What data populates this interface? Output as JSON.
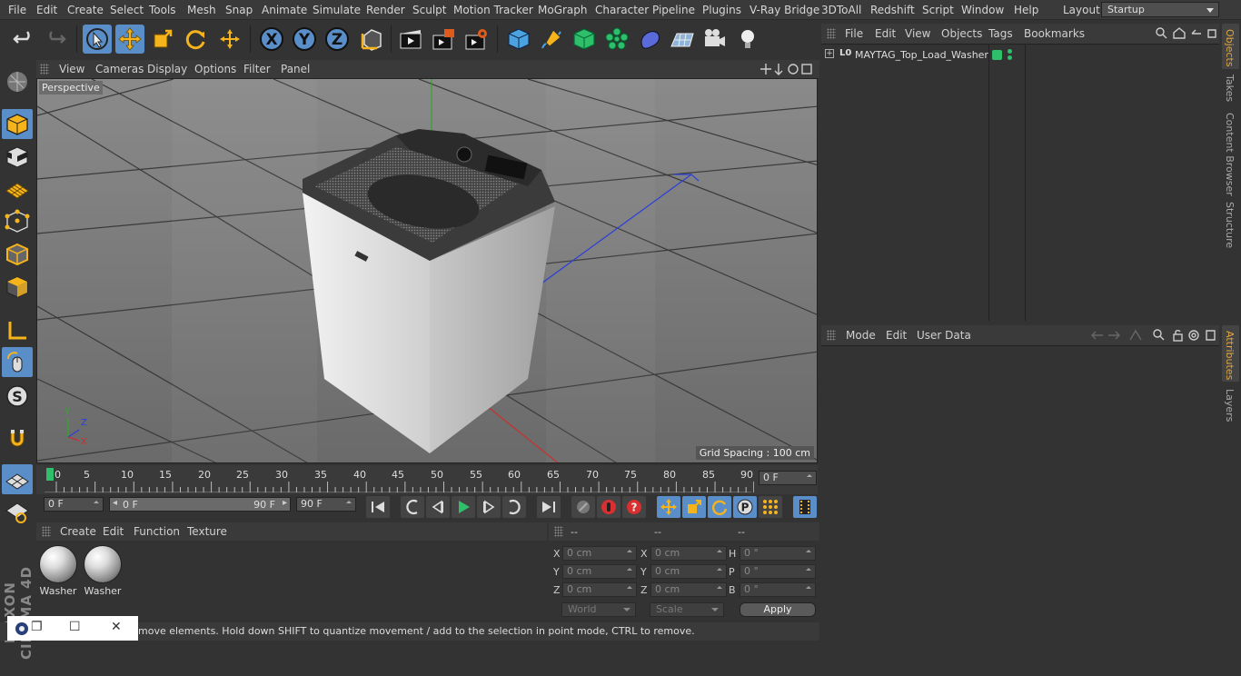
{
  "menubar": {
    "items": [
      "File",
      "Edit",
      "Create",
      "Select",
      "Tools",
      "Mesh",
      "Snap",
      "Animate",
      "Simulate",
      "Render",
      "Sculpt",
      "Motion Tracker",
      "MoGraph",
      "Character",
      "Pipeline",
      "Plugins",
      "V-Ray Bridge",
      "3DToAll",
      "Redshift",
      "Script",
      "Window",
      "Help"
    ],
    "layout_label": "Layout:",
    "layout_value": "Startup"
  },
  "toolbar": {
    "icons": [
      "undo-icon",
      "redo-icon",
      "live-selection-icon",
      "move-icon",
      "scale-icon",
      "rotate-icon",
      "recent-tool-icon",
      "x-axis-icon",
      "y-axis-icon",
      "z-axis-icon",
      "coordinate-system-icon",
      "render-view-icon",
      "render-picture-viewer-icon",
      "edit-render-settings-icon",
      "cube-icon",
      "pen-icon",
      "subdivision-icon",
      "cloner-icon",
      "deformer-icon",
      "floor-icon",
      "camera-icon",
      "light-icon"
    ]
  },
  "left_toolbar": {
    "icons": [
      "make-editable-icon",
      "model-mode-icon",
      "texture-mode-icon",
      "workplane-icon",
      "points-mode-icon",
      "edges-mode-icon",
      "polygons-mode-icon",
      "axis-mode-icon",
      "tweak-mode-icon",
      "solo-mode-icon",
      "snap-magnet-icon",
      "workplane-grid-icon",
      "locked-workplane-icon"
    ],
    "logo": "MAXON CINEMA 4D"
  },
  "viewport": {
    "menu": [
      "View",
      "Cameras",
      "Display",
      "Options",
      "Filter",
      "Panel"
    ],
    "label": "Perspective",
    "grid_spacing": "Grid Spacing : 100 cm",
    "axis_labels": [
      "Y",
      "Z",
      "X"
    ]
  },
  "timeline": {
    "ticks": [
      "0",
      "5",
      "10",
      "15",
      "20",
      "25",
      "30",
      "35",
      "40",
      "45",
      "50",
      "55",
      "60",
      "65",
      "70",
      "75",
      "80",
      "85",
      "90"
    ],
    "current_frame": "0 F"
  },
  "playback": {
    "start_field": "0 F",
    "range_start": "0 F",
    "range_end": "90 F",
    "end_field": "90 F"
  },
  "materials": {
    "menu": [
      "Create",
      "Edit",
      "Function",
      "Texture"
    ],
    "items": [
      {
        "name": "Washer"
      },
      {
        "name": "Washer"
      }
    ]
  },
  "coordinates": {
    "headers": [
      "--",
      "--",
      "--"
    ],
    "rows": [
      {
        "l1": "X",
        "v1": "0 cm",
        "l2": "X",
        "v2": "0 cm",
        "l3": "H",
        "v3": "0 °"
      },
      {
        "l1": "Y",
        "v1": "0 cm",
        "l2": "Y",
        "v2": "0 cm",
        "l3": "P",
        "v3": "0 °"
      },
      {
        "l1": "Z",
        "v1": "0 cm",
        "l2": "Z",
        "v2": "0 cm",
        "l3": "B",
        "v3": "0 °"
      }
    ],
    "space": "World",
    "mode": "Scale",
    "apply": "Apply"
  },
  "status": {
    "text": "move elements. Hold down SHIFT to quantize movement / add to the selection in point mode, CTRL to remove."
  },
  "objects": {
    "menu": [
      "File",
      "Edit",
      "View",
      "Objects",
      "Tags",
      "Bookmarks"
    ],
    "tree": [
      {
        "name": "MAYTAG_Top_Load_Washer",
        "layer_code": "L0"
      }
    ]
  },
  "attributes": {
    "menu": [
      "Mode",
      "Edit",
      "User Data"
    ]
  },
  "right_tabs": {
    "top": [
      "Objects",
      "Takes",
      "Content Browser",
      "Structure"
    ],
    "bottom": [
      "Attributes",
      "Layers"
    ]
  },
  "colors": {
    "accent": "#5a8ec9",
    "viewport_bg": "#7c7c7c",
    "axis_y": "#2fa82f",
    "axis_z": "#2a3fd8",
    "axis_x": "#c83030",
    "active_tab": "#e0a640"
  }
}
